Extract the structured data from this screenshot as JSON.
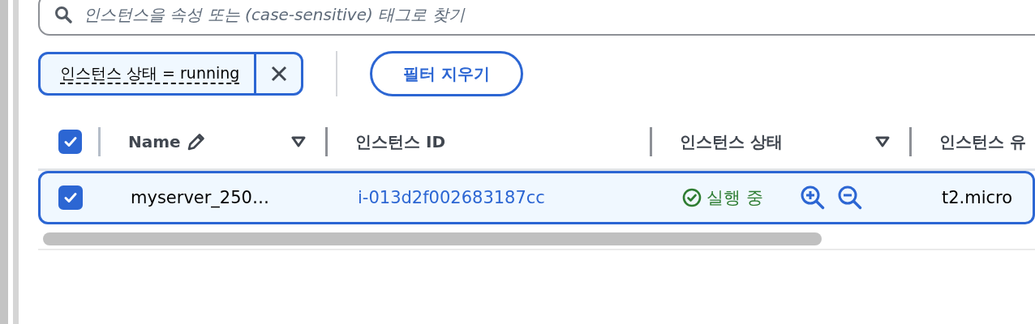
{
  "search": {
    "placeholder": "인스턴스을 속성 또는 (case-sensitive) 태그로 찾기"
  },
  "filter_token": {
    "label": "인스턴스 상태 = running"
  },
  "clear_filters_button": "필터 지우기",
  "table": {
    "select_all_checked": true,
    "columns": [
      {
        "label": "Name",
        "editable": true,
        "filterable": true
      },
      {
        "label": "인스턴스 ID",
        "editable": false,
        "filterable": false
      },
      {
        "label": "인스턴스 상태",
        "editable": false,
        "filterable": true
      },
      {
        "label": "인스턴스 유"
      }
    ],
    "rows": [
      {
        "selected": true,
        "name": "myserver_250…",
        "instance_id": "i-013d2f002683187cc",
        "state": {
          "label": "실행 중",
          "kind": "running"
        },
        "instance_type": "t2.micro"
      }
    ]
  }
}
